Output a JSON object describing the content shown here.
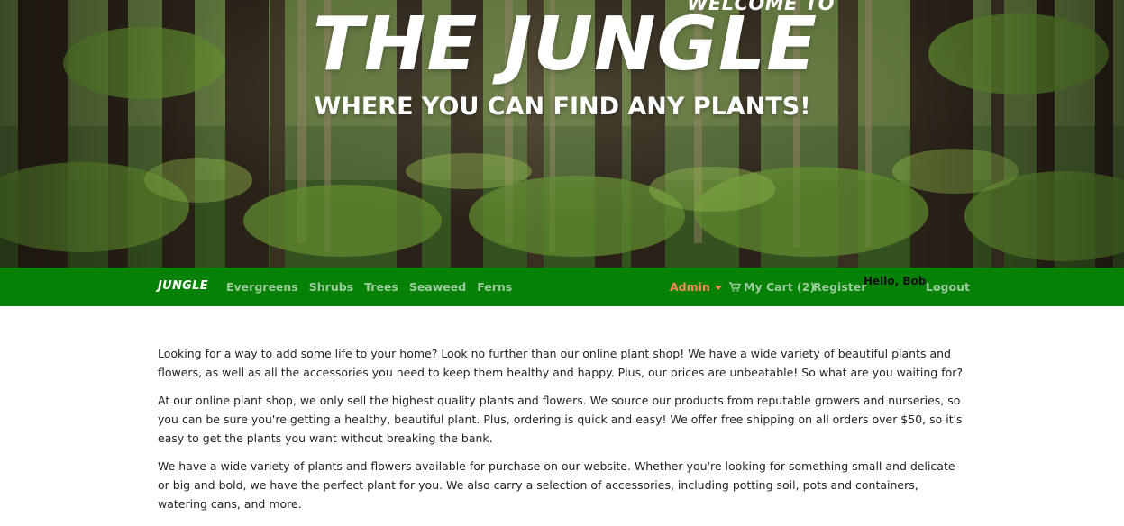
{
  "hero": {
    "welcome": "WELCOME TO",
    "title": "THE JUNGLE",
    "tagline": "WHERE YOU CAN FIND ANY PLANTS!"
  },
  "navbar": {
    "brand": "JUNGLE",
    "links": [
      "Evergreens",
      "Shrubs",
      "Trees",
      "Seaweed",
      "Ferns"
    ],
    "admin": "Admin",
    "cart": "My Cart (2)",
    "register": "Register",
    "hello": "Hello, Bob",
    "logout": "Logout",
    "colors": {
      "bar": "#058105",
      "admin": "#ff8a5b"
    }
  },
  "content": {
    "paragraphs": [
      "Looking for a way to add some life to your home? Look no further than our online plant shop! We have a wide variety of beautiful plants and flowers, as well as all the accessories you need to keep them healthy and happy. Plus, our prices are unbeatable! So what are you waiting for?",
      "At our online plant shop, we only sell the highest quality plants and flowers. We source our products from reputable growers and nurseries, so you can be sure you're getting a healthy, beautiful plant. Plus, ordering is quick and easy! We offer free shipping on all orders over $50, so it's easy to get the plants you want without breaking the bank.",
      "We have a wide variety of plants and flowers available for purchase on our website. Whether you're looking for something small and delicate or big and bold, we have the perfect plant for you. We also carry a selection of accessories, including potting soil, pots and containers, watering cans, and more."
    ]
  }
}
